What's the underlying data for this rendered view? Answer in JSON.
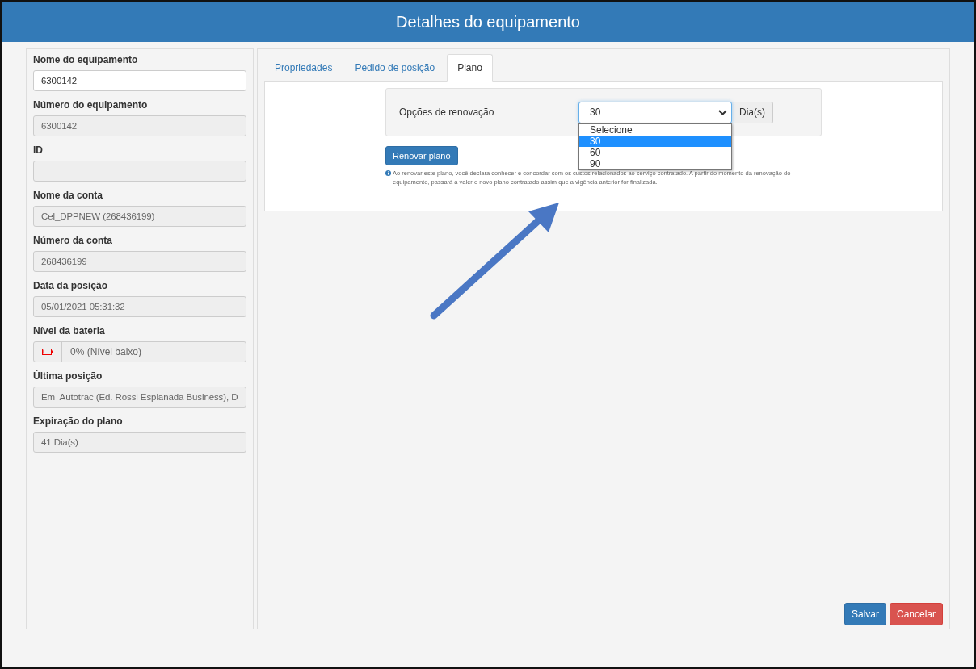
{
  "window": {
    "title": "Detalhes do equipamento"
  },
  "fields": [
    {
      "label": "Nome do equipamento",
      "value": "6300142",
      "disabled": false,
      "kind": "text"
    },
    {
      "label": "Número do equipamento",
      "value": "6300142",
      "disabled": true,
      "kind": "text"
    },
    {
      "label": "ID",
      "disabled": true,
      "kind": "text"
    },
    {
      "label": "Nome da conta",
      "value": "Cel_DPPNEW (268436199)",
      "disabled": true,
      "kind": "text"
    },
    {
      "label": "Número da conta",
      "value": "268436199",
      "disabled": true,
      "kind": "text"
    },
    {
      "label": "Data da posição",
      "value": "05/01/2021 05:31:32",
      "disabled": true,
      "kind": "text"
    },
    {
      "label": "Nível da bateria",
      "value": "0% (Nível baixo)",
      "disabled": true,
      "kind": "battery",
      "level": 0.1
    },
    {
      "label": "Última posição",
      "value": "Em  Autotrac (Ed. Rossi Esplanada Business), D",
      "disabled": true,
      "kind": "text"
    },
    {
      "label": "Expiração do plano",
      "value": "41 Dia(s)",
      "disabled": true,
      "kind": "text"
    }
  ],
  "tabs": [
    {
      "label": "Propriedades",
      "selected": false
    },
    {
      "label": "Pedido de posição",
      "selected": false
    },
    {
      "label": "Plano",
      "selected": true
    }
  ],
  "renewal": {
    "label": "Opções de renovação",
    "value": "30",
    "unit": "Dia(s)",
    "options": [
      {
        "label": "Selecione",
        "selected": false
      },
      {
        "label": "30",
        "selected": true
      },
      {
        "label": "60",
        "selected": false
      },
      {
        "label": "90",
        "selected": false
      }
    ],
    "button": "Renovar plano",
    "notice": "Ao renovar este plano, você declara conhecer e concordar com os custos relacionados ao serviço contratado. A partir do momento da renovação do equipamento, passará a valer o novo plano contratado assim que a vigência anterior for finalizada."
  },
  "buttons": [
    {
      "label": "Salvar",
      "kind": "primary"
    },
    {
      "label": "Cancelar",
      "kind": "danger"
    }
  ]
}
